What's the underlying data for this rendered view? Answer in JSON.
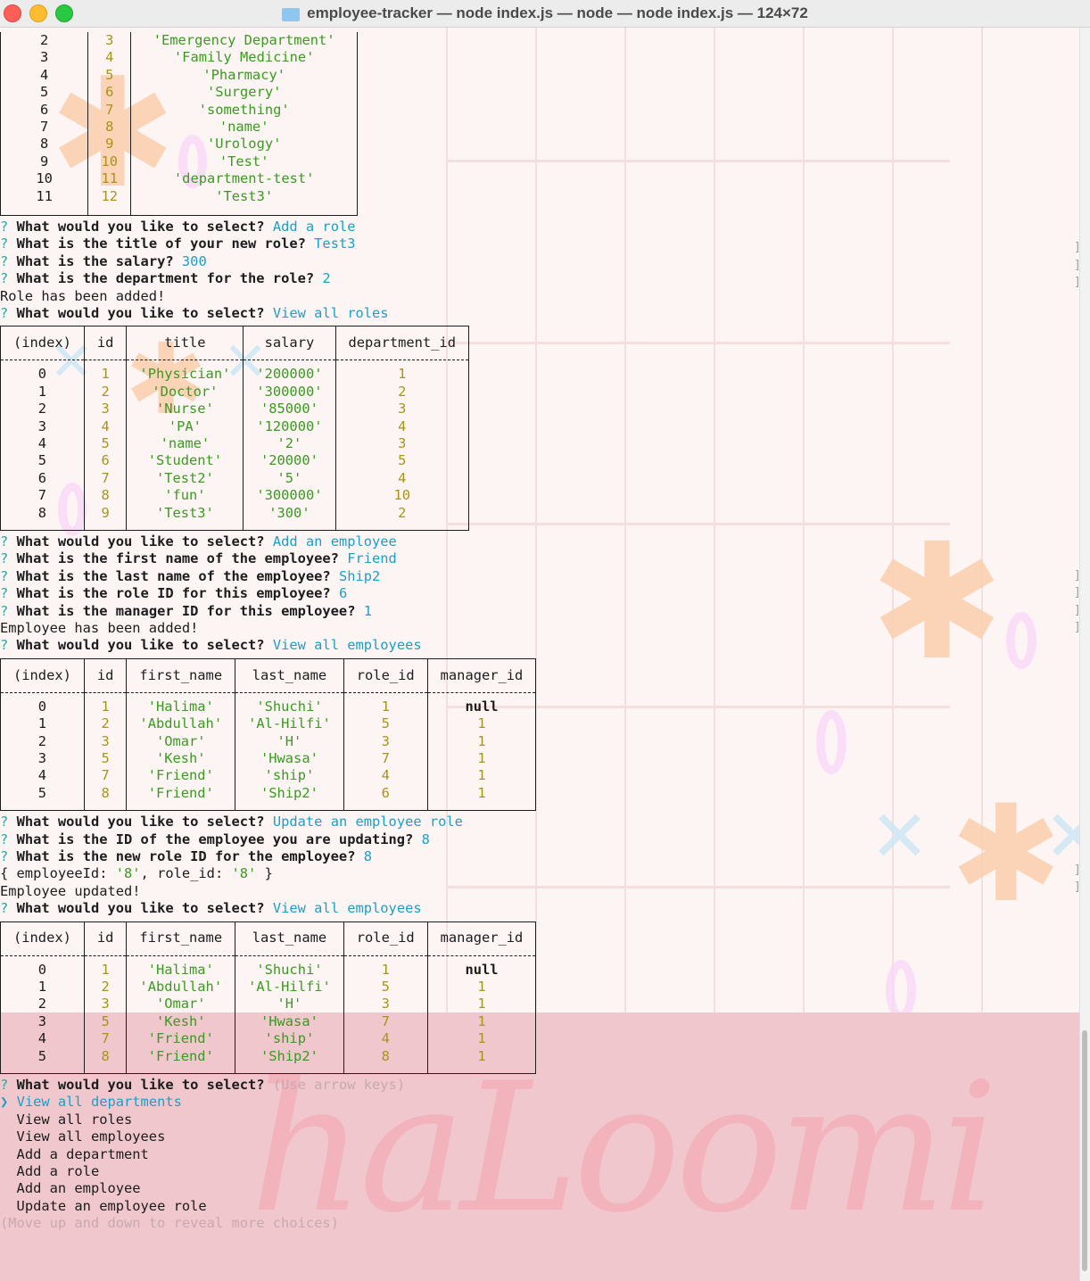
{
  "window": {
    "title": "employee-tracker — node index.js — node — node index.js — 124×72"
  },
  "colors": {
    "prompt": "#2ea8a0",
    "answer": "#1aa0c8",
    "string": "#3a9a22",
    "number": "#a89418"
  },
  "departments_partial": {
    "rows": [
      {
        "index": "2",
        "id": "3",
        "name": "'Emergency Department'"
      },
      {
        "index": "3",
        "id": "4",
        "name": "'Family Medicine'"
      },
      {
        "index": "4",
        "id": "5",
        "name": "'Pharmacy'"
      },
      {
        "index": "5",
        "id": "6",
        "name": "'Surgery'"
      },
      {
        "index": "6",
        "id": "7",
        "name": "'something'"
      },
      {
        "index": "7",
        "id": "8",
        "name": "'name'"
      },
      {
        "index": "8",
        "id": "9",
        "name": "'Urology'"
      },
      {
        "index": "9",
        "id": "10",
        "name": "'Test'"
      },
      {
        "index": "10",
        "id": "11",
        "name": "'department-test'"
      },
      {
        "index": "11",
        "id": "12",
        "name": "'Test3'"
      }
    ]
  },
  "block1": {
    "q1": "What would you like to select?",
    "a1": "Add a role",
    "q2": "What is the title of your new role?",
    "a2": "Test3",
    "q3": "What is the salary?",
    "a3": "300",
    "q4": "What is the department for the role?",
    "a4": "2",
    "msg": "Role has been added!",
    "q5": "What would you like to select?",
    "a5": "View all roles"
  },
  "roles": {
    "headers": [
      "(index)",
      "id",
      "title",
      "salary",
      "department_id"
    ],
    "rows": [
      {
        "index": "0",
        "id": "1",
        "title": "'Physician'",
        "salary": "'200000'",
        "department_id": "1"
      },
      {
        "index": "1",
        "id": "2",
        "title": "'Doctor'",
        "salary": "'300000'",
        "department_id": "2"
      },
      {
        "index": "2",
        "id": "3",
        "title": "'Nurse'",
        "salary": "'85000'",
        "department_id": "3"
      },
      {
        "index": "3",
        "id": "4",
        "title": "'PA'",
        "salary": "'120000'",
        "department_id": "4"
      },
      {
        "index": "4",
        "id": "5",
        "title": "'name'",
        "salary": "'2'",
        "department_id": "3"
      },
      {
        "index": "5",
        "id": "6",
        "title": "'Student'",
        "salary": "'20000'",
        "department_id": "5"
      },
      {
        "index": "6",
        "id": "7",
        "title": "'Test2'",
        "salary": "'5'",
        "department_id": "4"
      },
      {
        "index": "7",
        "id": "8",
        "title": "'fun'",
        "salary": "'300000'",
        "department_id": "10"
      },
      {
        "index": "8",
        "id": "9",
        "title": "'Test3'",
        "salary": "'300'",
        "department_id": "2"
      }
    ]
  },
  "block2": {
    "q1": "What would you like to select?",
    "a1": "Add an employee",
    "q2": "What is the first name of the employee?",
    "a2": "Friend",
    "q3": "What is the last name of the employee?",
    "a3": "Ship2",
    "q4": "What is the role ID for this employee?",
    "a4": "6",
    "q5": "What is the manager ID for this employee?",
    "a5": "1",
    "msg": "Employee has been added!",
    "q6": "What would you like to select?",
    "a6": "View all employees"
  },
  "employees1": {
    "headers": [
      "(index)",
      "id",
      "first_name",
      "last_name",
      "role_id",
      "manager_id"
    ],
    "rows": [
      {
        "index": "0",
        "id": "1",
        "first_name": "'Halima'",
        "last_name": "'Shuchi'",
        "role_id": "1",
        "manager_id": "null"
      },
      {
        "index": "1",
        "id": "2",
        "first_name": "'Abdullah'",
        "last_name": "'Al-Hilfi'",
        "role_id": "5",
        "manager_id": "1"
      },
      {
        "index": "2",
        "id": "3",
        "first_name": "'Omar'",
        "last_name": "'H'",
        "role_id": "3",
        "manager_id": "1"
      },
      {
        "index": "3",
        "id": "5",
        "first_name": "'Kesh'",
        "last_name": "'Hwasa'",
        "role_id": "7",
        "manager_id": "1"
      },
      {
        "index": "4",
        "id": "7",
        "first_name": "'Friend'",
        "last_name": "'ship'",
        "role_id": "4",
        "manager_id": "1"
      },
      {
        "index": "5",
        "id": "8",
        "first_name": "'Friend'",
        "last_name": "'Ship2'",
        "role_id": "6",
        "manager_id": "1"
      }
    ]
  },
  "block3": {
    "q1": "What would you like to select?",
    "a1": "Update an employee role",
    "q2": "What is the ID of the employee you are updating?",
    "a2": "8",
    "q3": "What is the new role ID for the employee?",
    "a3": "8",
    "obj_pre": "{ employeeId: ",
    "obj_v1": "'8'",
    "obj_mid": ", role_id: ",
    "obj_v2": "'8'",
    "obj_post": " }",
    "msg": "Employee updated!",
    "q4": "What would you like to select?",
    "a4": "View all employees"
  },
  "employees2": {
    "headers": [
      "(index)",
      "id",
      "first_name",
      "last_name",
      "role_id",
      "manager_id"
    ],
    "rows": [
      {
        "index": "0",
        "id": "1",
        "first_name": "'Halima'",
        "last_name": "'Shuchi'",
        "role_id": "1",
        "manager_id": "null"
      },
      {
        "index": "1",
        "id": "2",
        "first_name": "'Abdullah'",
        "last_name": "'Al-Hilfi'",
        "role_id": "5",
        "manager_id": "1"
      },
      {
        "index": "2",
        "id": "3",
        "first_name": "'Omar'",
        "last_name": "'H'",
        "role_id": "3",
        "manager_id": "1"
      },
      {
        "index": "3",
        "id": "5",
        "first_name": "'Kesh'",
        "last_name": "'Hwasa'",
        "role_id": "7",
        "manager_id": "1"
      },
      {
        "index": "4",
        "id": "7",
        "first_name": "'Friend'",
        "last_name": "'ship'",
        "role_id": "4",
        "manager_id": "1"
      },
      {
        "index": "5",
        "id": "8",
        "first_name": "'Friend'",
        "last_name": "'Ship2'",
        "role_id": "8",
        "manager_id": "1"
      }
    ]
  },
  "menu": {
    "question": "What would you like to select?",
    "hint": "(Use arrow keys)",
    "pointer": "❯",
    "choices": [
      "View all departments",
      "View all roles",
      "View all employees",
      "Add a department",
      "Add a role",
      "Add an employee",
      "Update an employee role"
    ],
    "footer": "(Move up and down to reveal more choices)"
  },
  "wallpaper": {
    "word": "haLoomi"
  },
  "prompt_mark": "?"
}
